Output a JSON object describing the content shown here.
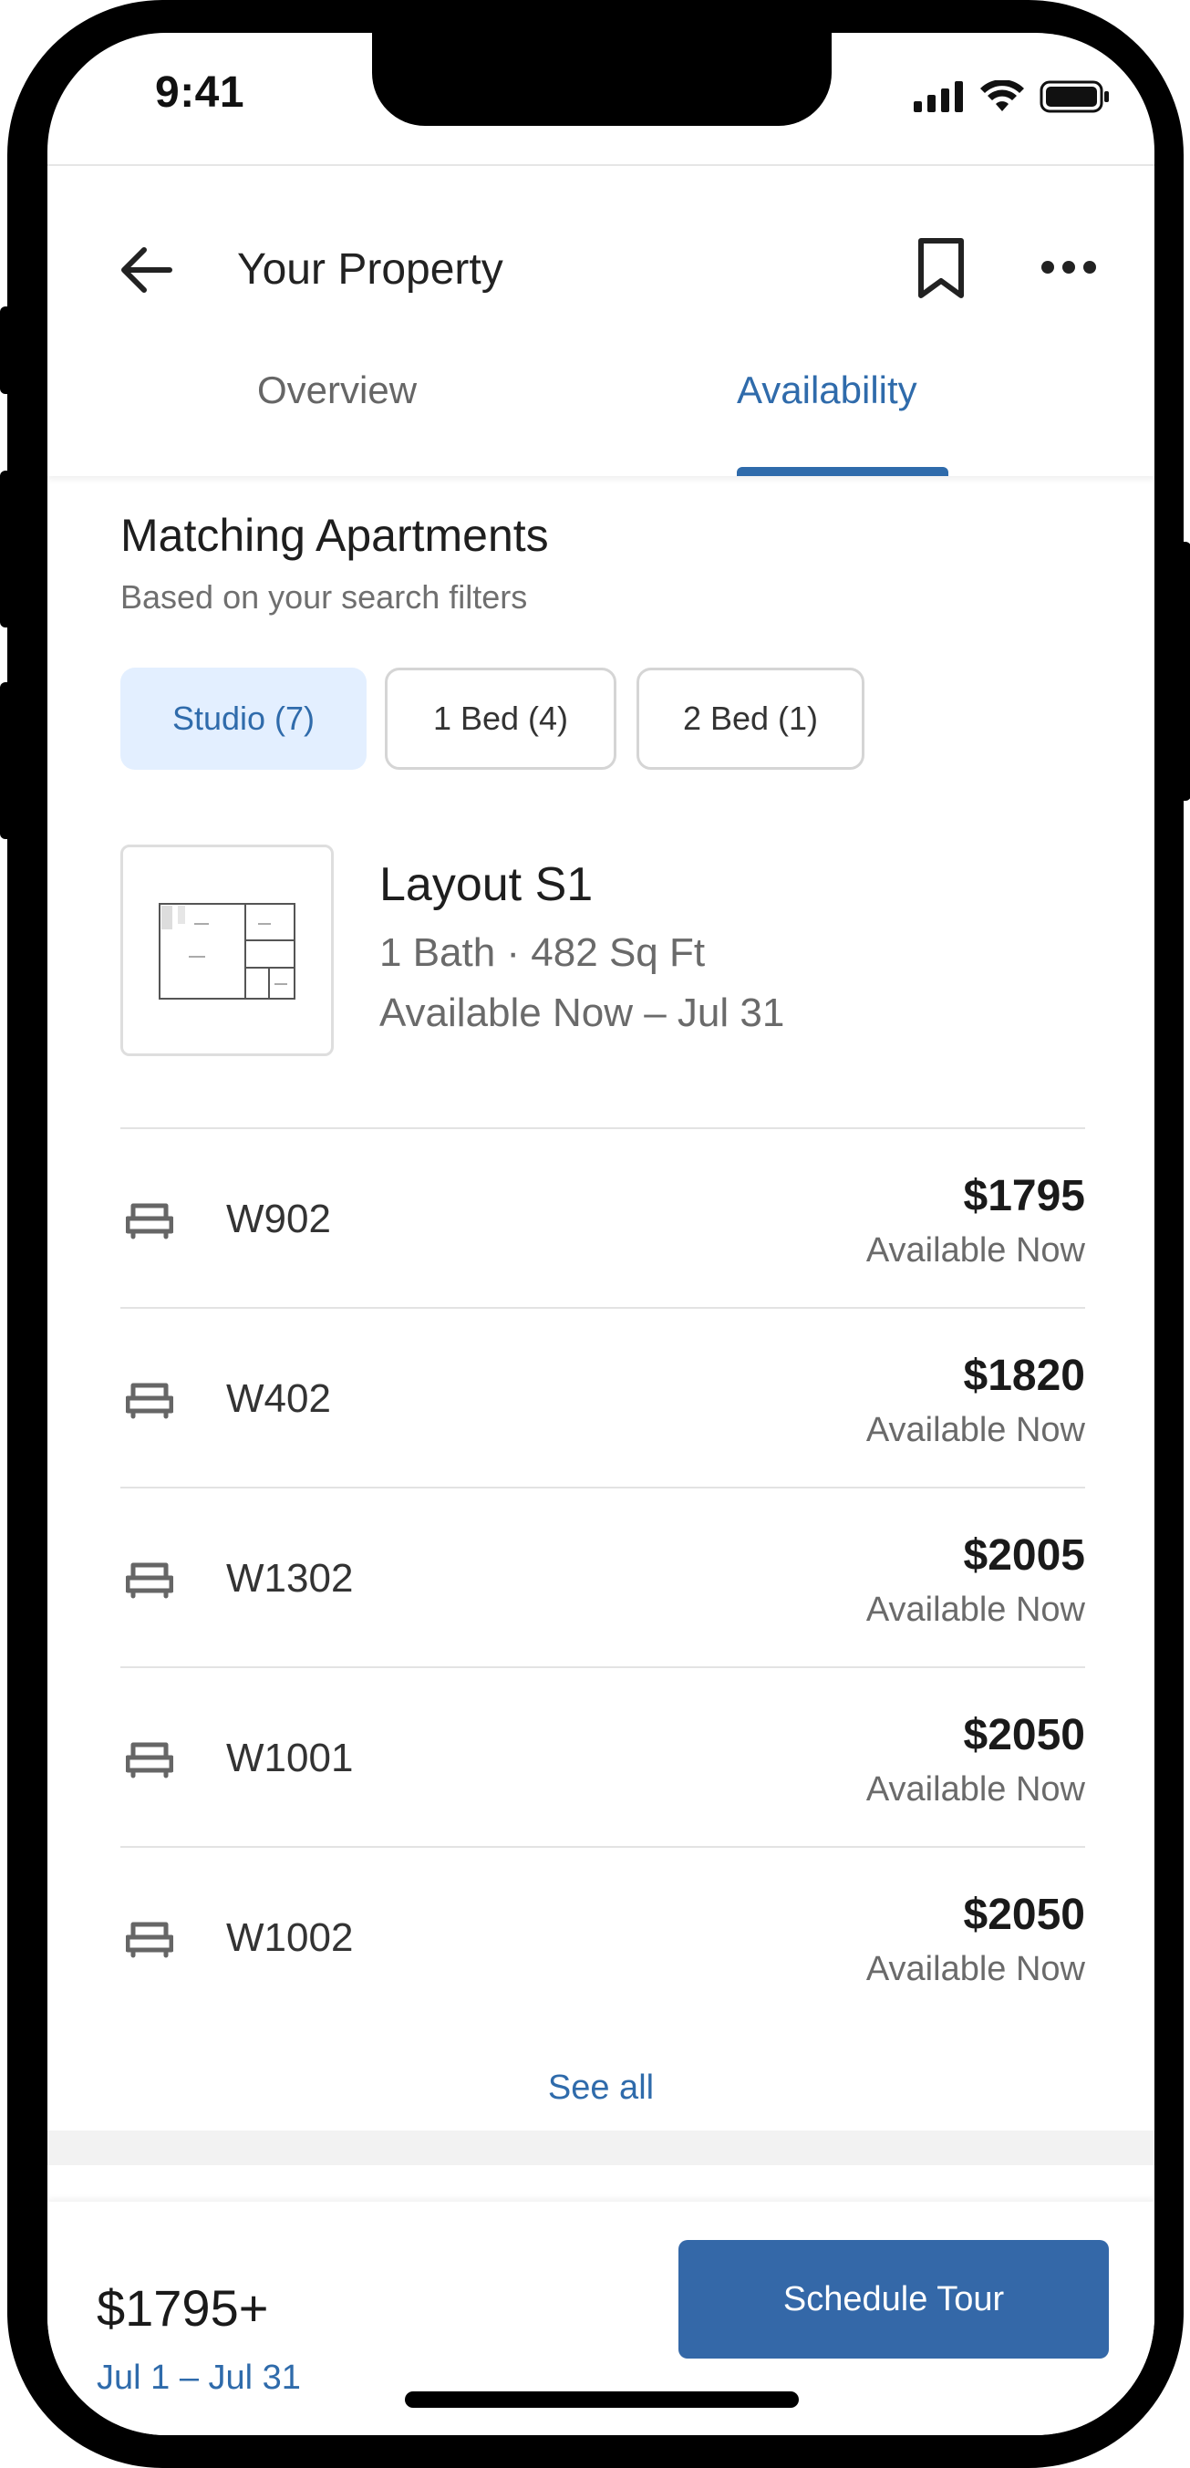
{
  "status_bar": {
    "time": "9:41"
  },
  "header": {
    "title": "Your Property",
    "tabs": [
      {
        "label": "Overview",
        "active": false
      },
      {
        "label": "Availability",
        "active": true
      }
    ]
  },
  "section": {
    "title": "Matching Apartments",
    "subtitle": "Based on your search filters"
  },
  "filters": [
    {
      "label": "Studio (7)",
      "selected": true
    },
    {
      "label": "1 Bed (4)",
      "selected": false
    },
    {
      "label": "2 Bed (1)",
      "selected": false
    }
  ],
  "layout": {
    "name": "Layout S1",
    "spec": "1 Bath · 482 Sq Ft",
    "availability": "Available Now – Jul 31",
    "thumbnail_icon": "floorplan-icon"
  },
  "units": [
    {
      "name": "W902",
      "price": "$1795",
      "availability": "Available Now"
    },
    {
      "name": "W402",
      "price": "$1820",
      "availability": "Available Now"
    },
    {
      "name": "W1302",
      "price": "$2005",
      "availability": "Available Now"
    },
    {
      "name": "W1001",
      "price": "$2050",
      "availability": "Available Now"
    },
    {
      "name": "W1002",
      "price": "$2050",
      "availability": "Available Now"
    }
  ],
  "see_all_label": "See all",
  "footer": {
    "price": "$1795+",
    "dates": "Jul 1 – Jul 31",
    "cta_label": "Schedule Tour"
  },
  "colors": {
    "accent": "#2f6bab",
    "chip_selected_bg": "#e3efff",
    "cta_bg": "#3468a8"
  },
  "icons": {
    "back": "arrow-left-icon",
    "bookmark": "bookmark-icon",
    "more": "more-horizontal-icon",
    "unit": "bed-icon"
  }
}
